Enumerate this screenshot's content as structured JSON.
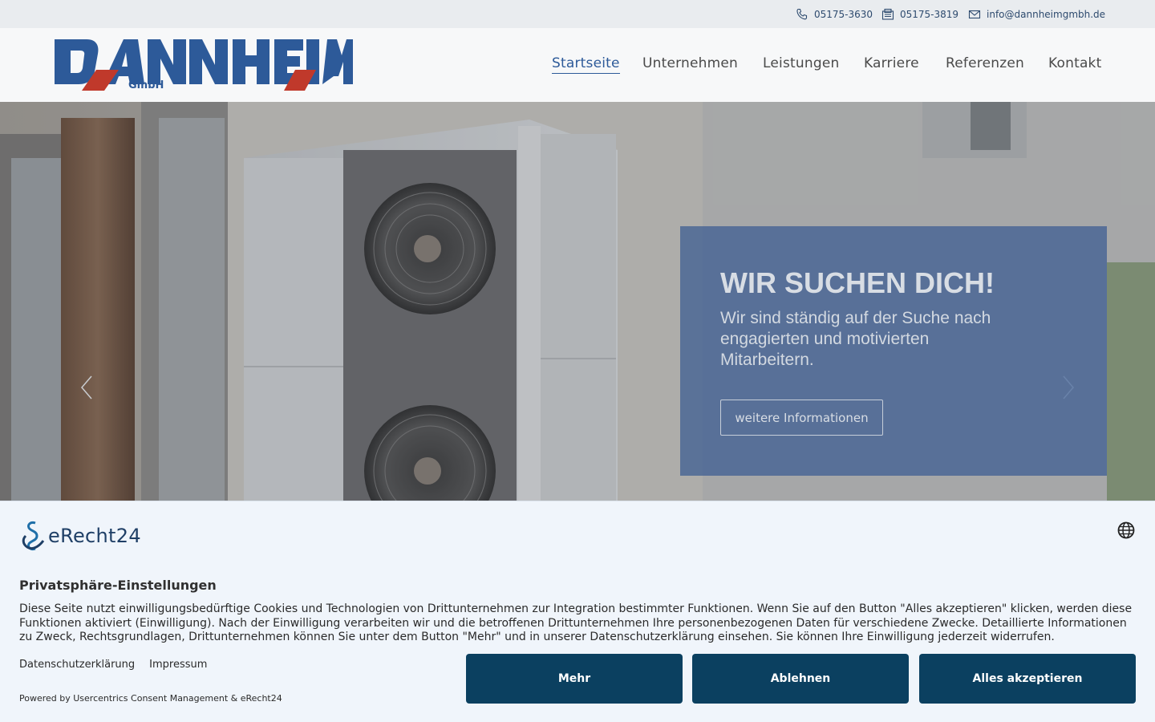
{
  "topbar": {
    "phone": "05175-3630",
    "fax": "05175-3819",
    "email": "info@dannheimgmbh.de",
    "icons": [
      "phone-icon",
      "fax-icon",
      "mail-icon"
    ]
  },
  "logo": {
    "name": "DANNHEIM",
    "suffix": "GmbH",
    "colors": {
      "blue": "#2d5a99",
      "red": "#c0392b"
    }
  },
  "nav": {
    "items": [
      {
        "label": "Startseite",
        "active": true
      },
      {
        "label": "Unternehmen",
        "active": false
      },
      {
        "label": "Leistungen",
        "active": false
      },
      {
        "label": "Karriere",
        "active": false
      },
      {
        "label": "Referenzen",
        "active": false
      },
      {
        "label": "Kontakt",
        "active": false
      }
    ]
  },
  "hero": {
    "title": "WIR SUCHEN DICH!",
    "text": "Wir sind ständig auf der Suche nach engagierten und motivierten Mitarbeitern.",
    "button": "weitere Informationen",
    "icons": [
      "chevron-left-icon",
      "chevron-right-icon"
    ]
  },
  "consent": {
    "brand": "eRecht24",
    "title": "Privatsphäre-Einstellungen",
    "description": "Diese Seite nutzt einwilligungsbedürftige Cookies und Technologien von Drittunternehmen zur Integration bestimmter Funktionen. Wenn Sie auf den Button \"Alles akzeptieren\" klicken, werden diese Funktionen aktiviert (Einwilligung). Nach der Einwilligung verarbeiten wir und die betroffenen Drittunternehmen Ihre personenbezogenen Daten für verschiedene Zwecke. Detaillierte Informationen zu Zweck, Rechtsgrundlagen, Drittunternehmen können Sie unter dem Button \"Mehr\" und in unserer Datenschutzerklärung einsehen. Sie können Ihre Einwilligung jederzeit widerrufen.",
    "link_privacy": "Datenschutzerklärung",
    "link_imprint": "Impressum",
    "powered": "Powered by Usercentrics Consent Management & eRecht24",
    "btn_more": "Mehr",
    "btn_decline": "Ablehnen",
    "btn_accept": "Alles akzeptieren",
    "accent": "#0b4060"
  }
}
